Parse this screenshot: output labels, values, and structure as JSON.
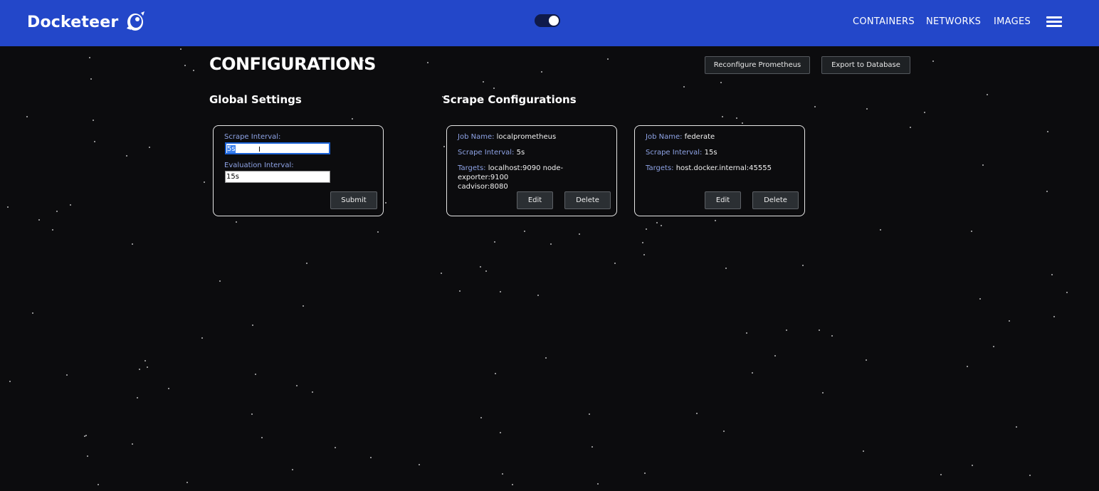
{
  "brand": {
    "name": "Docketeer"
  },
  "nav": {
    "containers": "CONTAINERS",
    "networks": "NETWORKS",
    "images": "IMAGES"
  },
  "page": {
    "title": "CONFIGURATIONS",
    "reconfigure_label": "Reconfigure Prometheus",
    "export_label": "Export to Database"
  },
  "global": {
    "heading": "Global Settings",
    "scrape_label": "Scrape Interval:",
    "scrape_value": "5s",
    "eval_label": "Evaluation Interval:",
    "eval_value": "15s",
    "submit_label": "Submit"
  },
  "scrape": {
    "heading": "Scrape Configurations",
    "jobs": [
      {
        "job_label": "Job Name:",
        "job_value": "localprometheus",
        "interval_label": "Scrape Interval:",
        "interval_value": "5s",
        "targets_label": "Targets:",
        "targets_value": "localhost:9090 node-exporter:9100",
        "targets_value_2": "cadvisor:8080",
        "edit_label": "Edit",
        "delete_label": "Delete"
      },
      {
        "job_label": "Job Name:",
        "job_value": "federate",
        "interval_label": "Scrape Interval:",
        "interval_value": "15s",
        "targets_label": "Targets:",
        "targets_value": "host.docker.internal:45555",
        "edit_label": "Edit",
        "delete_label": "Delete"
      }
    ]
  },
  "colors": {
    "navbar": "#2347c9",
    "label": "#8ea3e6",
    "background": "#0c0c0e"
  },
  "icons": {
    "brand_logo": "rocket-mascot-icon",
    "theme_toggle": "toggle-switch",
    "menu": "hamburger-icon"
  }
}
